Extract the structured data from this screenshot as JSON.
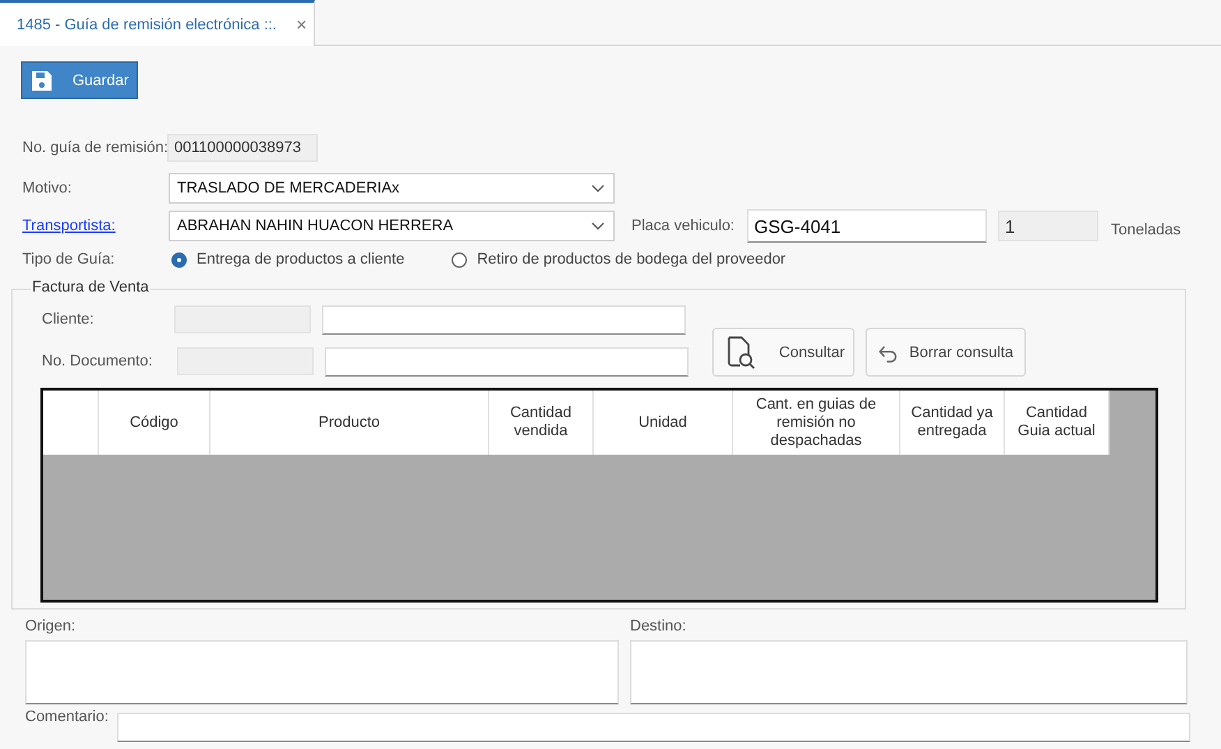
{
  "tabs": [
    {
      "label": "1485 - Guía de remisión electrónica ::.",
      "selected": true,
      "close": "×"
    }
  ],
  "toolbar": {
    "buttons": [
      {
        "label": "Guardar",
        "kind": "save"
      }
    ]
  },
  "numero_guia": {
    "label": "No. guía de remisión:",
    "value": "001100000038973"
  },
  "motivo": {
    "label": "Motivo:",
    "value": "TRASLADO DE MERCADERIAx"
  },
  "transportista": {
    "label": "Transportista:",
    "value": "ABRAHAN NAHIN HUACON HERRERA"
  },
  "placa": {
    "label": "Placa vehiculo:",
    "value": "GSG-4041"
  },
  "capacidad": {
    "value": "1",
    "unit": "Toneladas"
  },
  "tipo_guia": {
    "label": "Tipo de Guía:",
    "options": [
      {
        "label": "Entrega de productos a cliente",
        "selected": true
      },
      {
        "label": "Retiro de productos de bodega del proveedor",
        "selected": false
      }
    ]
  },
  "factura": {
    "title": "Factura de Venta",
    "cliente": {
      "label": "Cliente:"
    },
    "documento": {
      "label": "No. Documento:"
    },
    "buttons": [
      {
        "label": "Consultar",
        "kind": "search"
      },
      {
        "label": "Borrar consulta",
        "kind": "undo"
      }
    ],
    "table": {
      "columns": [
        "Código",
        "Producto",
        "Cantidad vendida",
        "Unidad",
        "Cant. en guias de remisión no despachadas",
        "Cantidad ya entregada",
        "Cantidad Guia actual"
      ]
    }
  },
  "origen": {
    "label": "Origen:"
  },
  "destino": {
    "label": "Destino:"
  },
  "comentario": {
    "label": "Comentario:"
  }
}
